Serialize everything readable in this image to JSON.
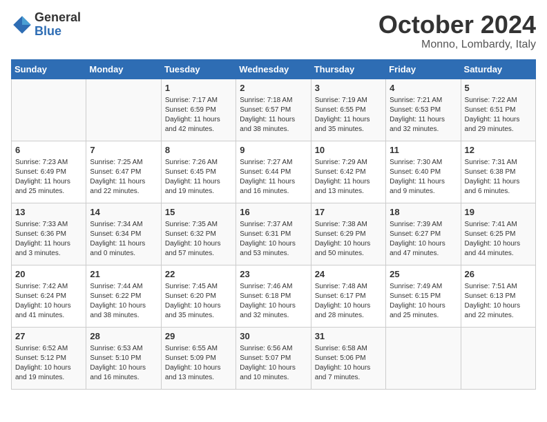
{
  "header": {
    "logo_general": "General",
    "logo_blue": "Blue",
    "month_title": "October 2024",
    "location": "Monno, Lombardy, Italy"
  },
  "days_of_week": [
    "Sunday",
    "Monday",
    "Tuesday",
    "Wednesday",
    "Thursday",
    "Friday",
    "Saturday"
  ],
  "weeks": [
    [
      {
        "day": "",
        "info": ""
      },
      {
        "day": "",
        "info": ""
      },
      {
        "day": "1",
        "info": "Sunrise: 7:17 AM\nSunset: 6:59 PM\nDaylight: 11 hours and 42 minutes."
      },
      {
        "day": "2",
        "info": "Sunrise: 7:18 AM\nSunset: 6:57 PM\nDaylight: 11 hours and 38 minutes."
      },
      {
        "day": "3",
        "info": "Sunrise: 7:19 AM\nSunset: 6:55 PM\nDaylight: 11 hours and 35 minutes."
      },
      {
        "day": "4",
        "info": "Sunrise: 7:21 AM\nSunset: 6:53 PM\nDaylight: 11 hours and 32 minutes."
      },
      {
        "day": "5",
        "info": "Sunrise: 7:22 AM\nSunset: 6:51 PM\nDaylight: 11 hours and 29 minutes."
      }
    ],
    [
      {
        "day": "6",
        "info": "Sunrise: 7:23 AM\nSunset: 6:49 PM\nDaylight: 11 hours and 25 minutes."
      },
      {
        "day": "7",
        "info": "Sunrise: 7:25 AM\nSunset: 6:47 PM\nDaylight: 11 hours and 22 minutes."
      },
      {
        "day": "8",
        "info": "Sunrise: 7:26 AM\nSunset: 6:45 PM\nDaylight: 11 hours and 19 minutes."
      },
      {
        "day": "9",
        "info": "Sunrise: 7:27 AM\nSunset: 6:44 PM\nDaylight: 11 hours and 16 minutes."
      },
      {
        "day": "10",
        "info": "Sunrise: 7:29 AM\nSunset: 6:42 PM\nDaylight: 11 hours and 13 minutes."
      },
      {
        "day": "11",
        "info": "Sunrise: 7:30 AM\nSunset: 6:40 PM\nDaylight: 11 hours and 9 minutes."
      },
      {
        "day": "12",
        "info": "Sunrise: 7:31 AM\nSunset: 6:38 PM\nDaylight: 11 hours and 6 minutes."
      }
    ],
    [
      {
        "day": "13",
        "info": "Sunrise: 7:33 AM\nSunset: 6:36 PM\nDaylight: 11 hours and 3 minutes."
      },
      {
        "day": "14",
        "info": "Sunrise: 7:34 AM\nSunset: 6:34 PM\nDaylight: 11 hours and 0 minutes."
      },
      {
        "day": "15",
        "info": "Sunrise: 7:35 AM\nSunset: 6:32 PM\nDaylight: 10 hours and 57 minutes."
      },
      {
        "day": "16",
        "info": "Sunrise: 7:37 AM\nSunset: 6:31 PM\nDaylight: 10 hours and 53 minutes."
      },
      {
        "day": "17",
        "info": "Sunrise: 7:38 AM\nSunset: 6:29 PM\nDaylight: 10 hours and 50 minutes."
      },
      {
        "day": "18",
        "info": "Sunrise: 7:39 AM\nSunset: 6:27 PM\nDaylight: 10 hours and 47 minutes."
      },
      {
        "day": "19",
        "info": "Sunrise: 7:41 AM\nSunset: 6:25 PM\nDaylight: 10 hours and 44 minutes."
      }
    ],
    [
      {
        "day": "20",
        "info": "Sunrise: 7:42 AM\nSunset: 6:24 PM\nDaylight: 10 hours and 41 minutes."
      },
      {
        "day": "21",
        "info": "Sunrise: 7:44 AM\nSunset: 6:22 PM\nDaylight: 10 hours and 38 minutes."
      },
      {
        "day": "22",
        "info": "Sunrise: 7:45 AM\nSunset: 6:20 PM\nDaylight: 10 hours and 35 minutes."
      },
      {
        "day": "23",
        "info": "Sunrise: 7:46 AM\nSunset: 6:18 PM\nDaylight: 10 hours and 32 minutes."
      },
      {
        "day": "24",
        "info": "Sunrise: 7:48 AM\nSunset: 6:17 PM\nDaylight: 10 hours and 28 minutes."
      },
      {
        "day": "25",
        "info": "Sunrise: 7:49 AM\nSunset: 6:15 PM\nDaylight: 10 hours and 25 minutes."
      },
      {
        "day": "26",
        "info": "Sunrise: 7:51 AM\nSunset: 6:13 PM\nDaylight: 10 hours and 22 minutes."
      }
    ],
    [
      {
        "day": "27",
        "info": "Sunrise: 6:52 AM\nSunset: 5:12 PM\nDaylight: 10 hours and 19 minutes."
      },
      {
        "day": "28",
        "info": "Sunrise: 6:53 AM\nSunset: 5:10 PM\nDaylight: 10 hours and 16 minutes."
      },
      {
        "day": "29",
        "info": "Sunrise: 6:55 AM\nSunset: 5:09 PM\nDaylight: 10 hours and 13 minutes."
      },
      {
        "day": "30",
        "info": "Sunrise: 6:56 AM\nSunset: 5:07 PM\nDaylight: 10 hours and 10 minutes."
      },
      {
        "day": "31",
        "info": "Sunrise: 6:58 AM\nSunset: 5:06 PM\nDaylight: 10 hours and 7 minutes."
      },
      {
        "day": "",
        "info": ""
      },
      {
        "day": "",
        "info": ""
      }
    ]
  ]
}
